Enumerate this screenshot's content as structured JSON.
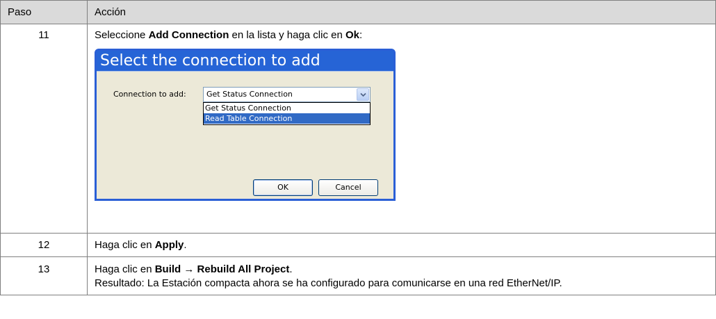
{
  "table": {
    "header": {
      "step": "Paso",
      "action": "Acción"
    },
    "rows": [
      {
        "step": "11",
        "text_pre": "Seleccione ",
        "bold_1": "Add Connection",
        "text_mid": " en la lista y haga clic en ",
        "bold_2": "Ok",
        "text_post": ":"
      },
      {
        "step": "12",
        "text_pre": "Haga clic en ",
        "bold_1": "Apply",
        "text_post": "."
      },
      {
        "step": "13",
        "text_pre": "Haga clic en ",
        "bold_1": "Build → Rebuild All Project",
        "text_post": ".",
        "result": "Resultado: La Estación compacta ahora se ha configurado para comunicarse en una red EtherNet/IP."
      }
    ]
  },
  "dialog": {
    "title": "Select the connection to add",
    "field_label": "Connection to add:",
    "combo_value": "Get Status Connection",
    "options": [
      "Get Status Connection",
      "Read Table Connection"
    ],
    "selected_option": "Read Table Connection",
    "ok_label": "OK",
    "cancel_label": "Cancel",
    "colors": {
      "title_bar": "#2664d6",
      "body": "#ece9d8",
      "selection": "#316ac5"
    }
  }
}
